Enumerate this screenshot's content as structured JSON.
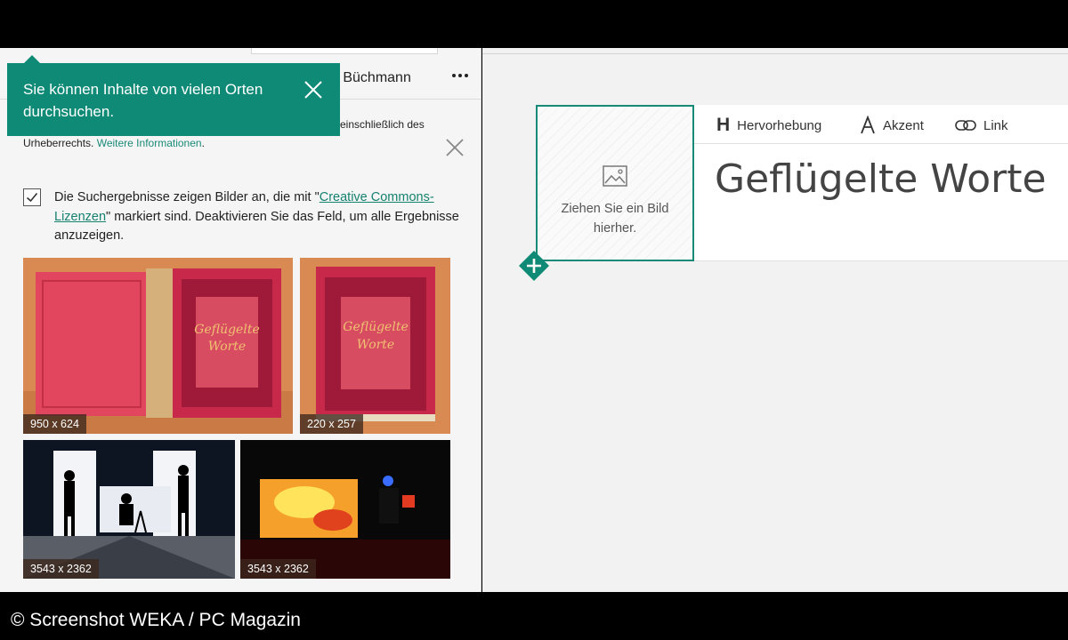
{
  "credit": "© Screenshot WEKA / PC Magazin",
  "search_pane": {
    "user_name": "g Büchmann",
    "more_label": "Weitere Optionen",
    "notice": {
      "line1_tail": "einschließlich des",
      "line2_prefix": "Urheberrechts.",
      "link": "Weitere Informationen"
    },
    "callout": {
      "text": "Sie können Inhalte von vielen Orten durchsuchen."
    },
    "creative_commons": {
      "checked": true,
      "text_before": "Die Suchergebnisse zeigen Bilder an, die mit \"",
      "link": "Creative Commons-Lizenzen",
      "text_after": "\" markiert sind. Deaktivieren Sie das Feld, um alle Ergebnisse anzuzeigen."
    },
    "results": [
      {
        "size": "950 x 624"
      },
      {
        "size": "220 x 257"
      },
      {
        "size": "3543 x 2362"
      },
      {
        "size": "3543 x 2362"
      }
    ]
  },
  "editor": {
    "toolbar": {
      "highlight": "Hervorhebung",
      "accent": "Akzent",
      "link": "Link"
    },
    "title": "Geflügelte Worte",
    "image_drop_text": "Ziehen Sie ein Bild hierher."
  },
  "colors": {
    "accent": "#0f8a76",
    "link": "#15816f"
  },
  "icons": [
    "close-icon",
    "checkbox-icon",
    "image-icon",
    "plus-icon",
    "link-icon",
    "more-icon"
  ]
}
